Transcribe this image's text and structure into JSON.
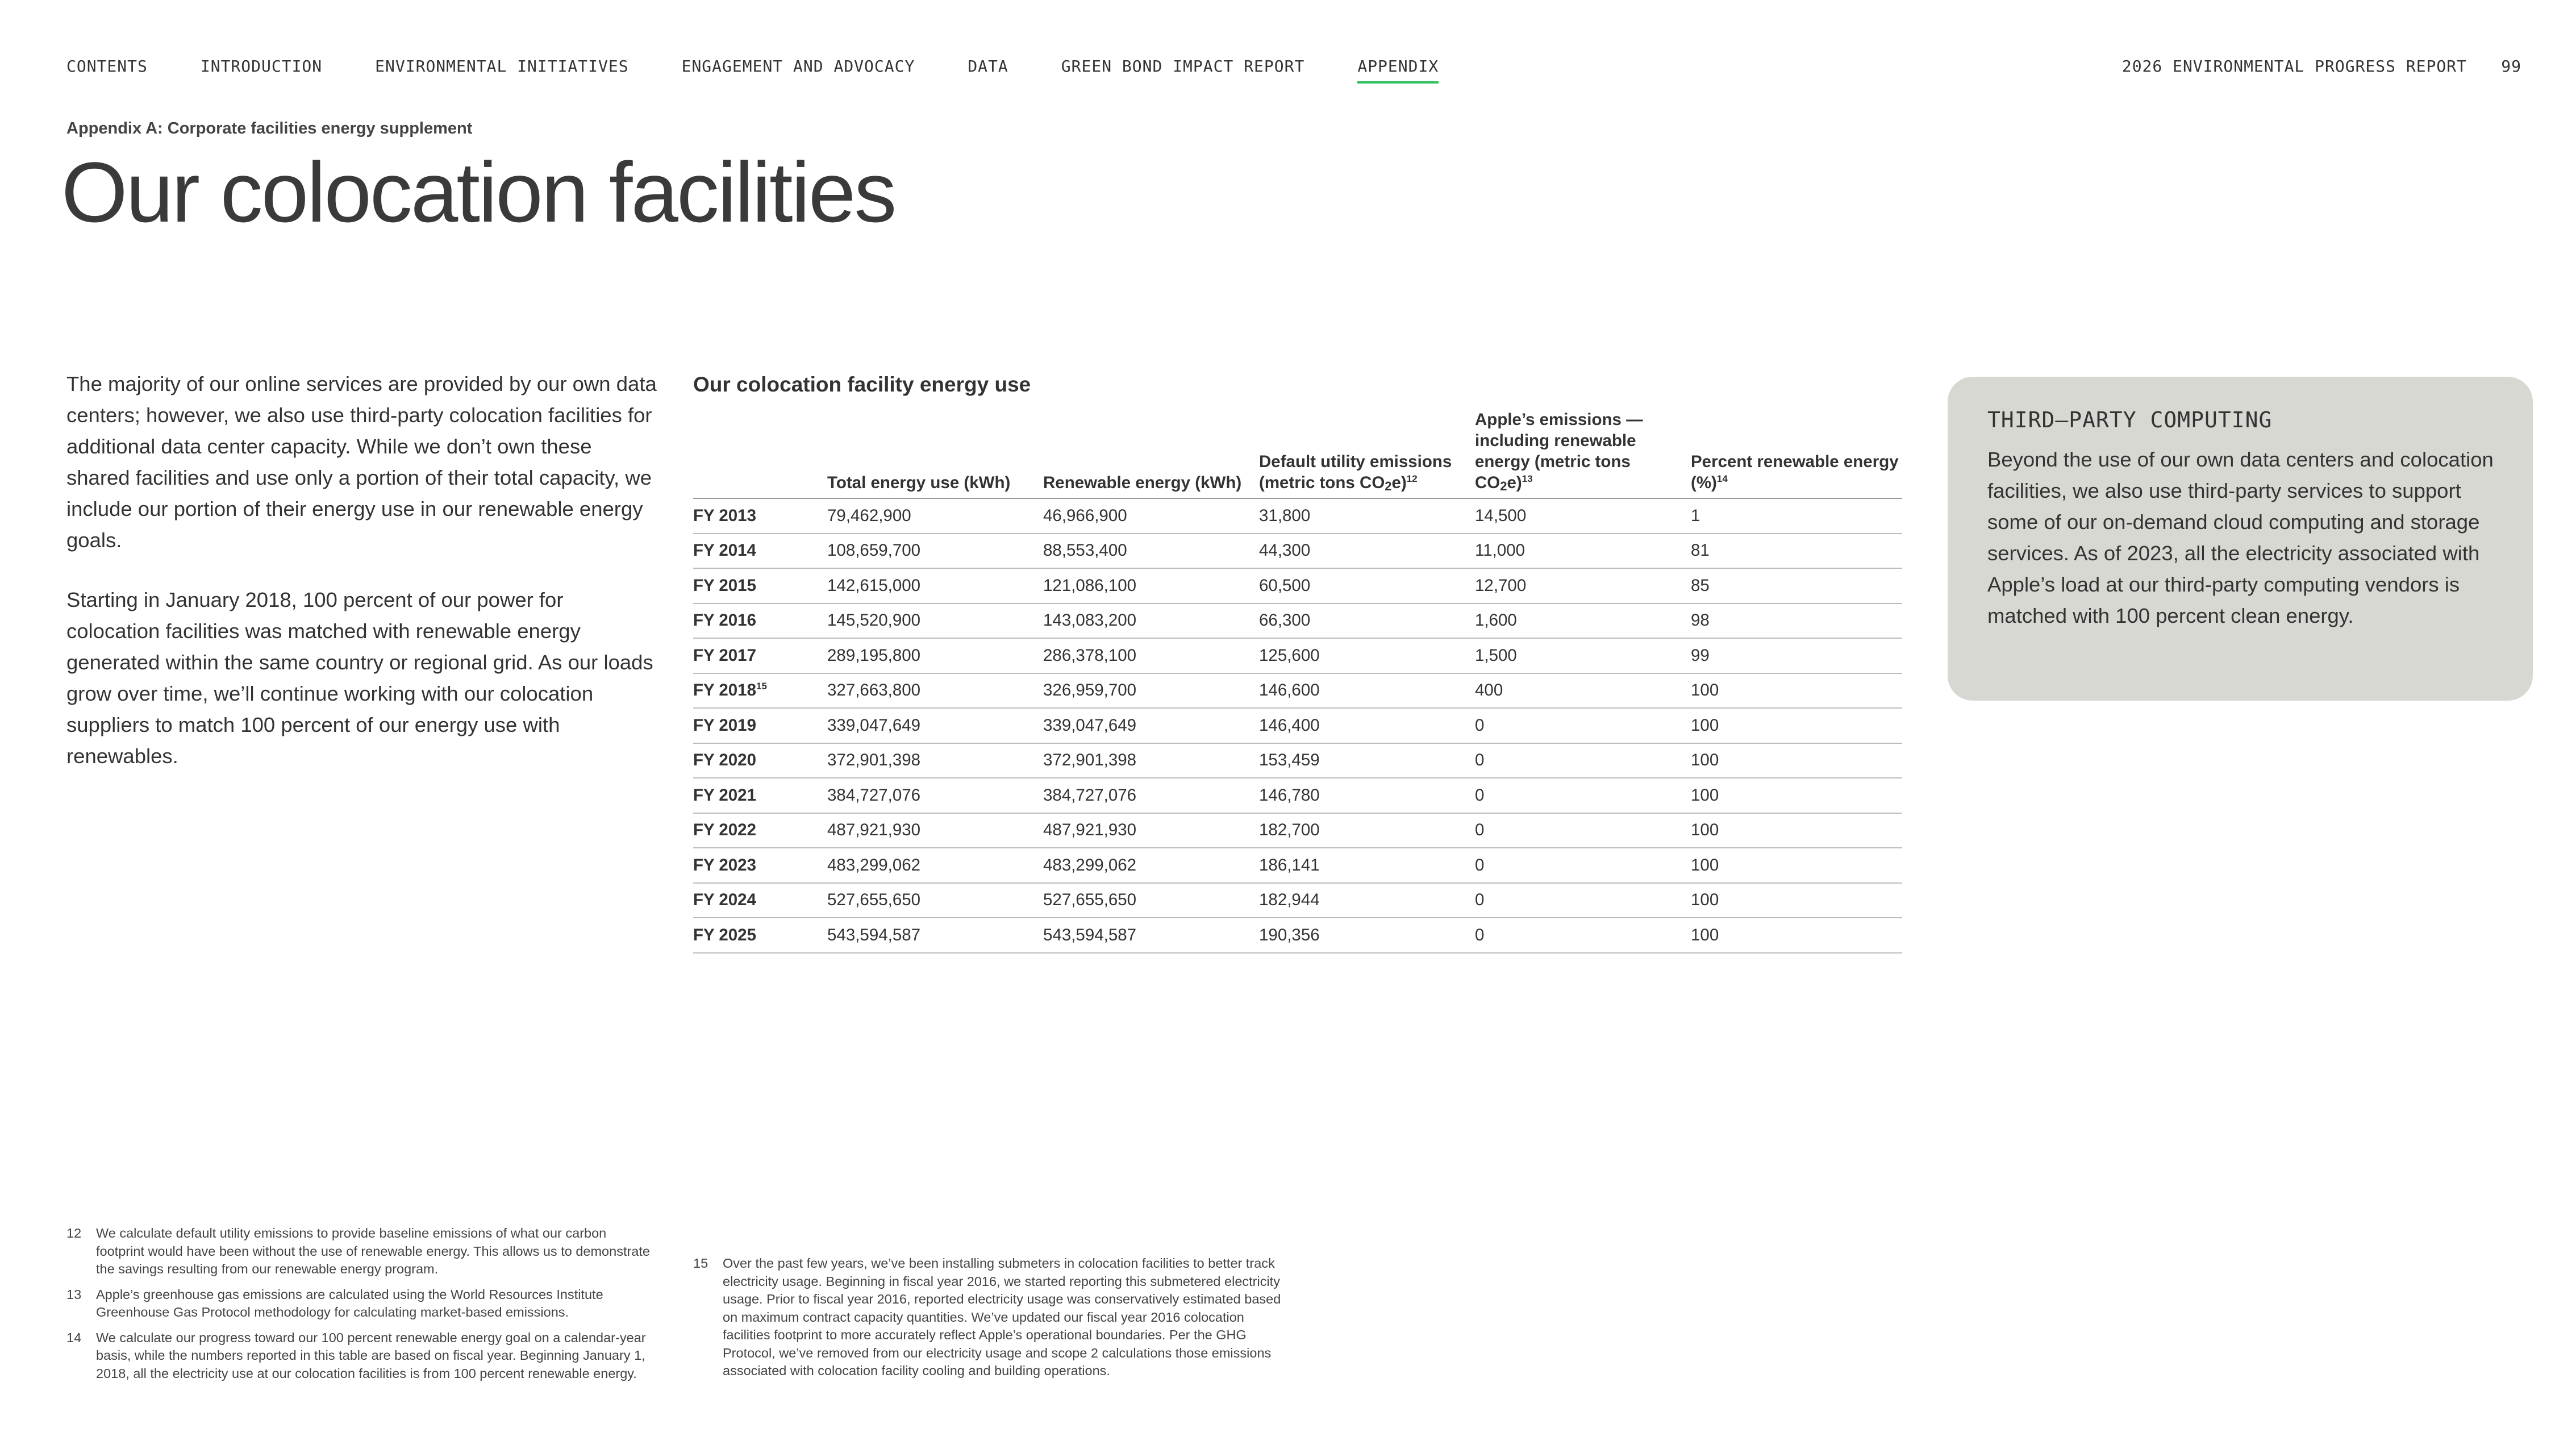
{
  "nav": {
    "items": [
      {
        "label": "CONTENTS",
        "active": false
      },
      {
        "label": "INTRODUCTION",
        "active": false
      },
      {
        "label": "ENVIRONMENTAL INITIATIVES",
        "active": false
      },
      {
        "label": "ENGAGEMENT AND ADVOCACY",
        "active": false
      },
      {
        "label": "DATA",
        "active": false
      },
      {
        "label": "GREEN BOND IMPACT REPORT",
        "active": false
      },
      {
        "label": "APPENDIX",
        "active": true
      }
    ],
    "report_title": "2026 ENVIRONMENTAL PROGRESS REPORT",
    "page_number": "99",
    "active_color": "#30c060"
  },
  "eyebrow": "Appendix A: Corporate facilities energy supplement",
  "title": "Our colocation facilities",
  "intro": {
    "paragraphs": [
      "The majority of our online services are provided by our own data centers; however, we also use third-party colocation facilities for additional data center capacity. While we don’t own these shared facilities and use only a portion of their total capacity, we include our portion of their energy use in our renewable energy goals.",
      "Starting in January 2018, 100 percent of our power for colocation facilities was matched with renewable energy generated within the same country or regional grid. As our loads grow over time, we’ll continue working with our colocation suppliers to match 100 percent of our energy use with renewables."
    ]
  },
  "table": {
    "title": "Our colocation facility energy use",
    "headers": {
      "total_energy": "Total energy use (kWh)",
      "renewable": "Renewable energy (kWh)",
      "default_a": "Default utility emissions (metric tons CO",
      "default_sub": "2",
      "default_b": "e)",
      "default_sup": "12",
      "apple_a": "Apple’s emissions — including renewable energy (metric tons CO",
      "apple_sub": "2",
      "apple_b": "e)",
      "apple_sup": "13",
      "percent": "Percent renewable energy (%)",
      "percent_sup": "14"
    },
    "rows": [
      {
        "fy": "FY 2013",
        "sup": "",
        "total": "79,462,900",
        "renewable": "46,966,900",
        "default": "31,800",
        "apple": "14,500",
        "percent": "1"
      },
      {
        "fy": "FY 2014",
        "sup": "",
        "total": "108,659,700",
        "renewable": "88,553,400",
        "default": "44,300",
        "apple": "11,000",
        "percent": "81"
      },
      {
        "fy": "FY 2015",
        "sup": "",
        "total": "142,615,000",
        "renewable": "121,086,100",
        "default": "60,500",
        "apple": "12,700",
        "percent": "85"
      },
      {
        "fy": "FY 2016",
        "sup": "",
        "total": "145,520,900",
        "renewable": "143,083,200",
        "default": "66,300",
        "apple": "1,600",
        "percent": "98"
      },
      {
        "fy": "FY 2017",
        "sup": "",
        "total": "289,195,800",
        "renewable": "286,378,100",
        "default": "125,600",
        "apple": "1,500",
        "percent": "99"
      },
      {
        "fy": "FY 2018",
        "sup": "15",
        "total": "327,663,800",
        "renewable": "326,959,700",
        "default": "146,600",
        "apple": "400",
        "percent": "100"
      },
      {
        "fy": "FY 2019",
        "sup": "",
        "total": "339,047,649",
        "renewable": "339,047,649",
        "default": "146,400",
        "apple": "0",
        "percent": "100"
      },
      {
        "fy": "FY 2020",
        "sup": "",
        "total": "372,901,398",
        "renewable": "372,901,398",
        "default": "153,459",
        "apple": "0",
        "percent": "100"
      },
      {
        "fy": "FY 2021",
        "sup": "",
        "total": "384,727,076",
        "renewable": "384,727,076",
        "default": "146,780",
        "apple": "0",
        "percent": "100"
      },
      {
        "fy": "FY 2022",
        "sup": "",
        "total": "487,921,930",
        "renewable": "487,921,930",
        "default": "182,700",
        "apple": "0",
        "percent": "100"
      },
      {
        "fy": "FY 2023",
        "sup": "",
        "total": "483,299,062",
        "renewable": "483,299,062",
        "default": "186,141",
        "apple": "0",
        "percent": "100"
      },
      {
        "fy": "FY 2024",
        "sup": "",
        "total": "527,655,650",
        "renewable": "527,655,650",
        "default": "182,944",
        "apple": "0",
        "percent": "100"
      },
      {
        "fy": "FY 2025",
        "sup": "",
        "total": "543,594,587",
        "renewable": "543,594,587",
        "default": "190,356",
        "apple": "0",
        "percent": "100"
      }
    ]
  },
  "sidebar": {
    "heading": "THIRD–PARTY COMPUTING",
    "body": "Beyond the use of our own data centers and colocation facilities, we also use third-party services to support some of our on-demand cloud computing and storage services. As of 2023, all the electricity associated with Apple’s load at our third-party computing vendors is matched with 100 percent clean energy.",
    "background": "#d8d8d3"
  },
  "footnotes_left": [
    {
      "num": "12",
      "text": "We calculate default utility emissions to provide baseline emissions of what our carbon footprint would have been without the use of renewable energy. This allows us to demonstrate the savings resulting from our renewable energy program."
    },
    {
      "num": "13",
      "text": "Apple’s greenhouse gas emissions are calculated using the World Resources Institute Greenhouse Gas Protocol methodology for calculating market-based emissions."
    },
    {
      "num": "14",
      "text": "We calculate our progress toward our 100 percent renewable energy goal on a calendar-year basis, while the numbers reported in this table are based on fiscal year. Beginning January 1, 2018, all the electricity use at our colocation facilities is from 100 percent renewable energy."
    }
  ],
  "footnotes_right": [
    {
      "num": "15",
      "text": "Over the past few years, we’ve been installing submeters in colocation facilities to better track electricity usage. Beginning in fiscal year 2016, we started reporting this submetered electricity usage. Prior to fiscal year 2016, reported electricity usage was conservatively estimated based on maximum contract capacity quantities. We’ve updated our fiscal year 2016 colocation facilities footprint to more accurately reflect Apple’s operational boundaries. Per the GHG Protocol, we’ve removed from our electricity usage and scope 2 calculations those emissions associated with colocation facility cooling and building operations."
    }
  ]
}
